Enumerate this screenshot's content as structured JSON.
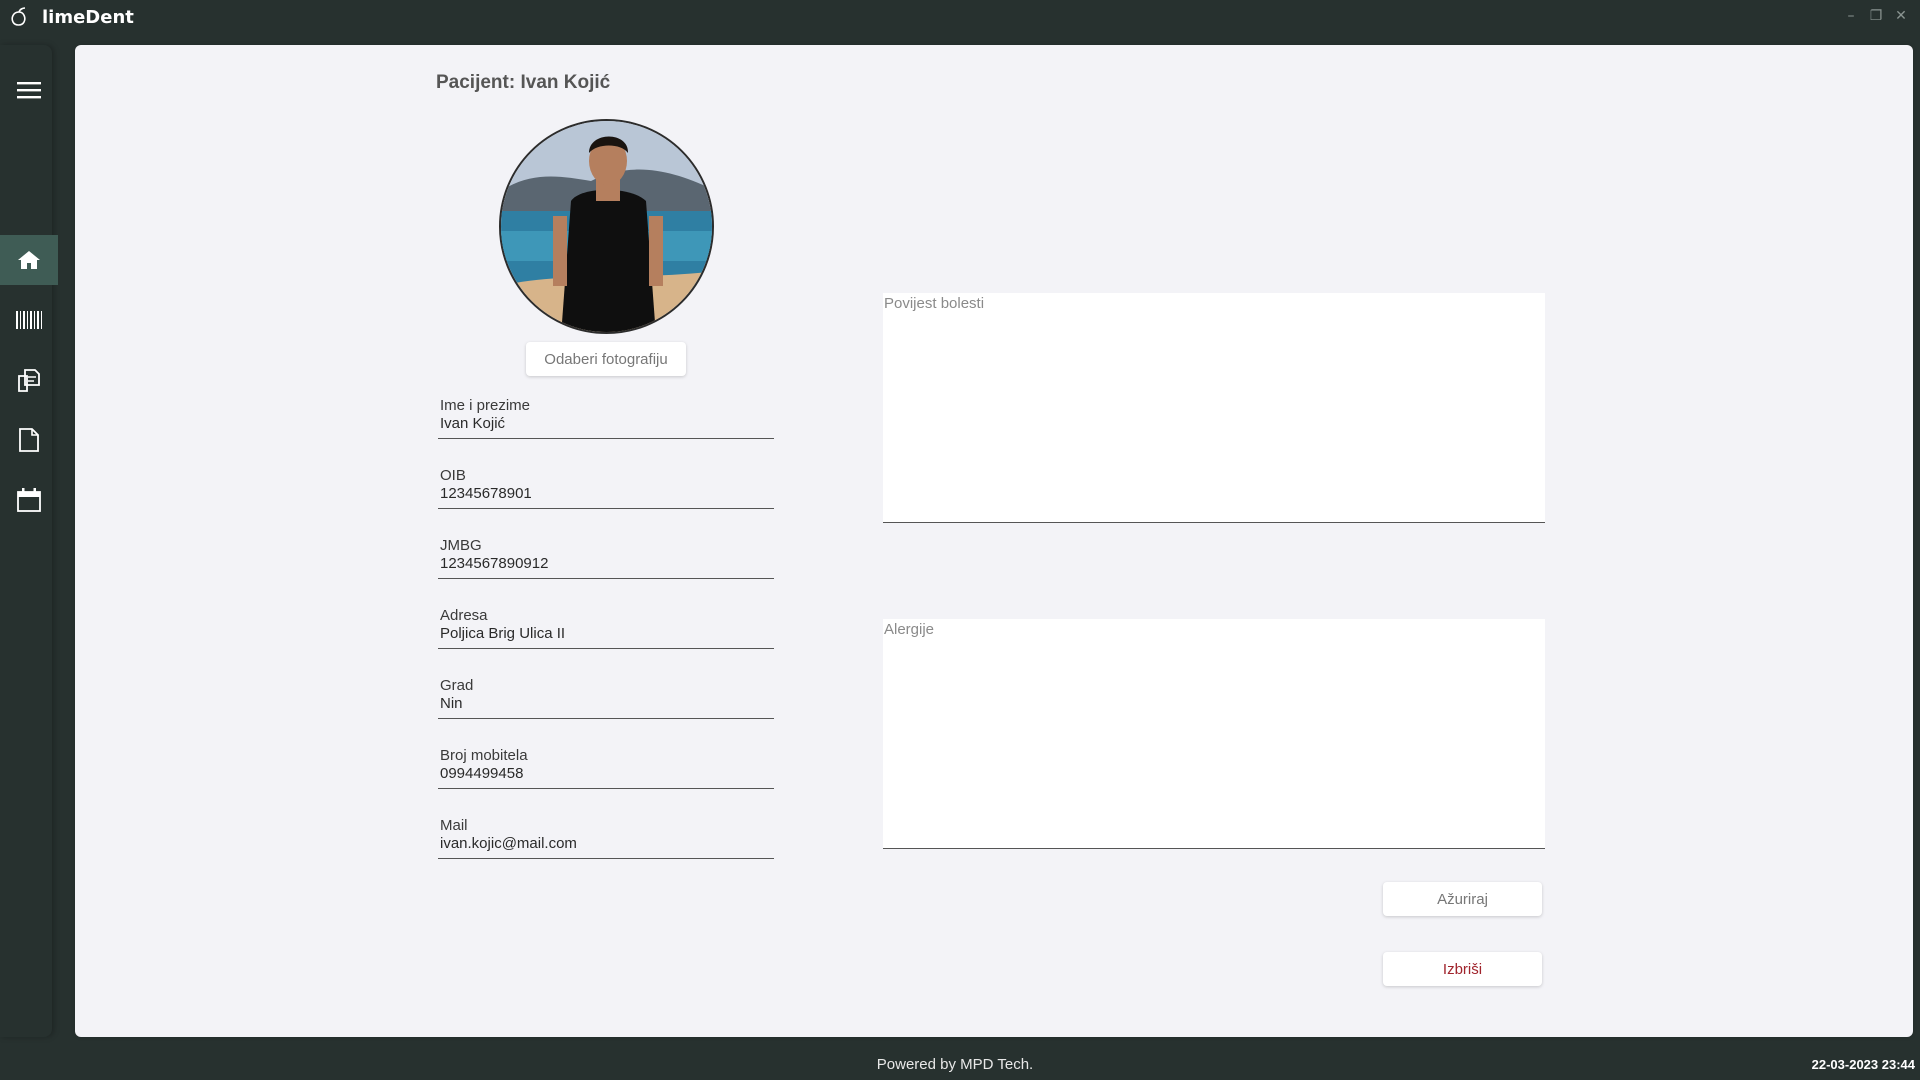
{
  "app": {
    "title": "limeDent",
    "window_controls": {
      "minimize": "–",
      "maximize": "❐",
      "close": "✕"
    }
  },
  "sidebar": {
    "items": [
      {
        "icon": "hamburger-menu-icon"
      },
      {
        "icon": "home-icon",
        "active": true
      },
      {
        "icon": "barcode-icon"
      },
      {
        "icon": "documents-icon"
      },
      {
        "icon": "file-icon"
      },
      {
        "icon": "calendar-icon"
      }
    ]
  },
  "patient": {
    "title": "Pacijent: Ivan Kojić",
    "photo_button": "Odaberi fotografiju",
    "fields": [
      {
        "label": "Ime i prezime",
        "value": "Ivan Kojić"
      },
      {
        "label": "OIB",
        "value": "12345678901"
      },
      {
        "label": "JMBG",
        "value": "1234567890912"
      },
      {
        "label": "Adresa",
        "value": "Poljica Brig Ulica II"
      },
      {
        "label": "Grad",
        "value": "Nin"
      },
      {
        "label": "Broj mobitela",
        "value": "0994499458"
      },
      {
        "label": "Mail",
        "value": "ivan.kojic@mail.com"
      }
    ],
    "medical_history_placeholder": "Povijest bolesti",
    "allergies_placeholder": "Alergije",
    "update_button": "Ažuriraj",
    "delete_button": "Izbriši"
  },
  "footer": {
    "powered_by": "Powered by MPD Tech.",
    "datetime": "22-03-2023 23:44"
  },
  "colors": {
    "sidebar_bg": "#27312f",
    "active_item": "#3f5c55",
    "card_bg": "#f3f3f7",
    "delete_text": "#a0242c"
  }
}
